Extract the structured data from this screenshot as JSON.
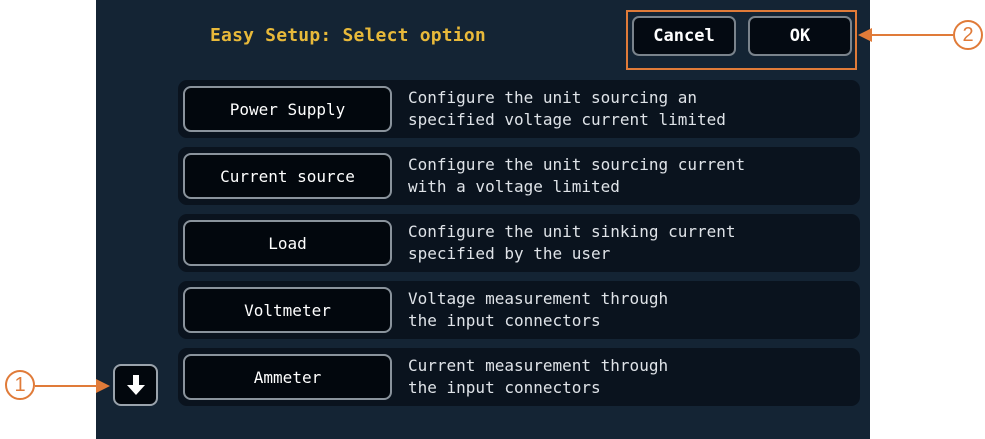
{
  "header": {
    "title": "Easy Setup: Select option",
    "cancel_label": "Cancel",
    "ok_label": "OK"
  },
  "options": [
    {
      "label": "Power Supply",
      "desc1": "Configure the unit sourcing an",
      "desc2": "specified voltage current limited"
    },
    {
      "label": "Current source",
      "desc1": "Configure the unit sourcing current",
      "desc2": "with a voltage limited"
    },
    {
      "label": "Load",
      "desc1": "Configure the unit sinking current",
      "desc2": "specified by the user"
    },
    {
      "label": "Voltmeter",
      "desc1": "Voltage measurement through",
      "desc2": "the input connectors"
    },
    {
      "label": "Ammeter",
      "desc1": "Current measurement through",
      "desc2": "the input connectors"
    }
  ],
  "scroll": {
    "icon": "arrow-down-icon"
  },
  "annotations": {
    "marker1": "1",
    "marker2": "2"
  },
  "colors": {
    "screen_bg": "#142434",
    "title": "#e8b93a",
    "callout": "#e07b39"
  }
}
